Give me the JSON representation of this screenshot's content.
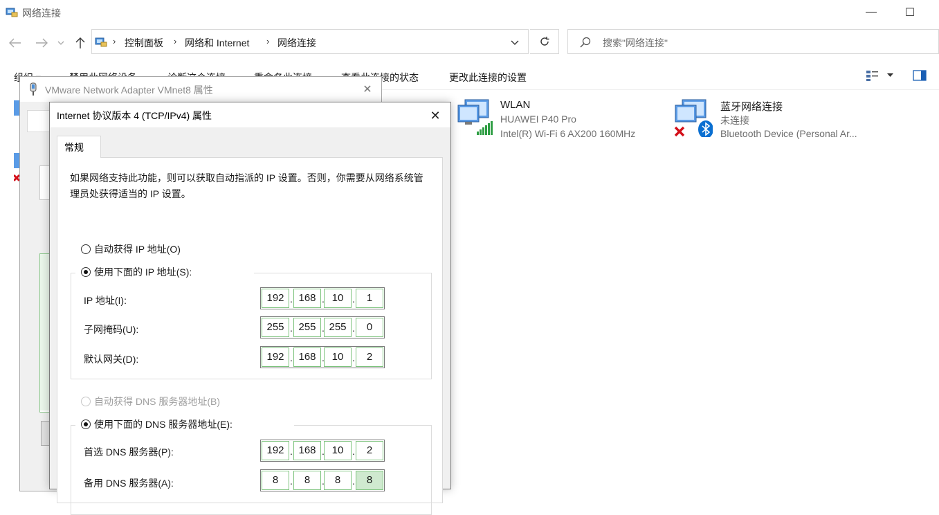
{
  "explorer": {
    "title": "网络连接",
    "minimize_glyph": "—",
    "maximize_glyph": "☐",
    "breadcrumb": [
      "控制面板",
      "网络和 Internet",
      "网络连接"
    ],
    "search_placeholder": "搜索\"网络连接\"",
    "commands": [
      "组织 ▾",
      "禁用此网络设备",
      "诊断这个连接",
      "重命名此连接",
      "查看此连接的状态",
      "更改此连接的设置"
    ],
    "icons": {
      "back": "back-arrow-icon",
      "forward": "forward-arrow-icon",
      "recent": "chevron-down-icon",
      "up": "up-arrow-icon",
      "refresh": "refresh-icon",
      "search": "search-icon"
    }
  },
  "connections": [
    {
      "name": "WLAN",
      "status": "HUAWEI P40 Pro",
      "device": "Intel(R) Wi-Fi 6 AX200 160MHz"
    },
    {
      "name": "蓝牙网络连接",
      "status": "未连接",
      "device": "Bluetooth Device (Personal Ar..."
    }
  ],
  "back_dialog": {
    "title": "VMware Network Adapter VMnet8 属性"
  },
  "dialog": {
    "title": "Internet 协议版本 4 (TCP/IPv4) 属性",
    "tab": "常规",
    "description": "如果网络支持此功能，则可以获取自动指派的 IP 设置。否则，你需要从网络系统管理员处获得适当的 IP 设置。",
    "auto_ip": "自动获得 IP 地址(O)",
    "manual_ip": "使用下面的 IP 地址(S):",
    "ip_label": "IP 地址(I):",
    "ip": [
      "192",
      "168",
      "10",
      "1"
    ],
    "mask_label": "子网掩码(U):",
    "mask": [
      "255",
      "255",
      "255",
      "0"
    ],
    "gateway_label": "默认网关(D):",
    "gateway": [
      "192",
      "168",
      "10",
      "2"
    ],
    "auto_dns": "自动获得 DNS 服务器地址(B)",
    "manual_dns": "使用下面的 DNS 服务器地址(E):",
    "dns1_label": "首选 DNS 服务器(P):",
    "dns1": [
      "192",
      "168",
      "10",
      "2"
    ],
    "dns2_label": "备用 DNS 服务器(A):",
    "dns2": [
      "8",
      "8",
      "8",
      "8"
    ]
  },
  "colors": {
    "selection_green": "#cfe9cf",
    "octet_border": "#7cc37c",
    "error_red": "#d3101a",
    "bluetooth_blue": "#0a6fd1",
    "signal_green": "#2f9e44"
  }
}
